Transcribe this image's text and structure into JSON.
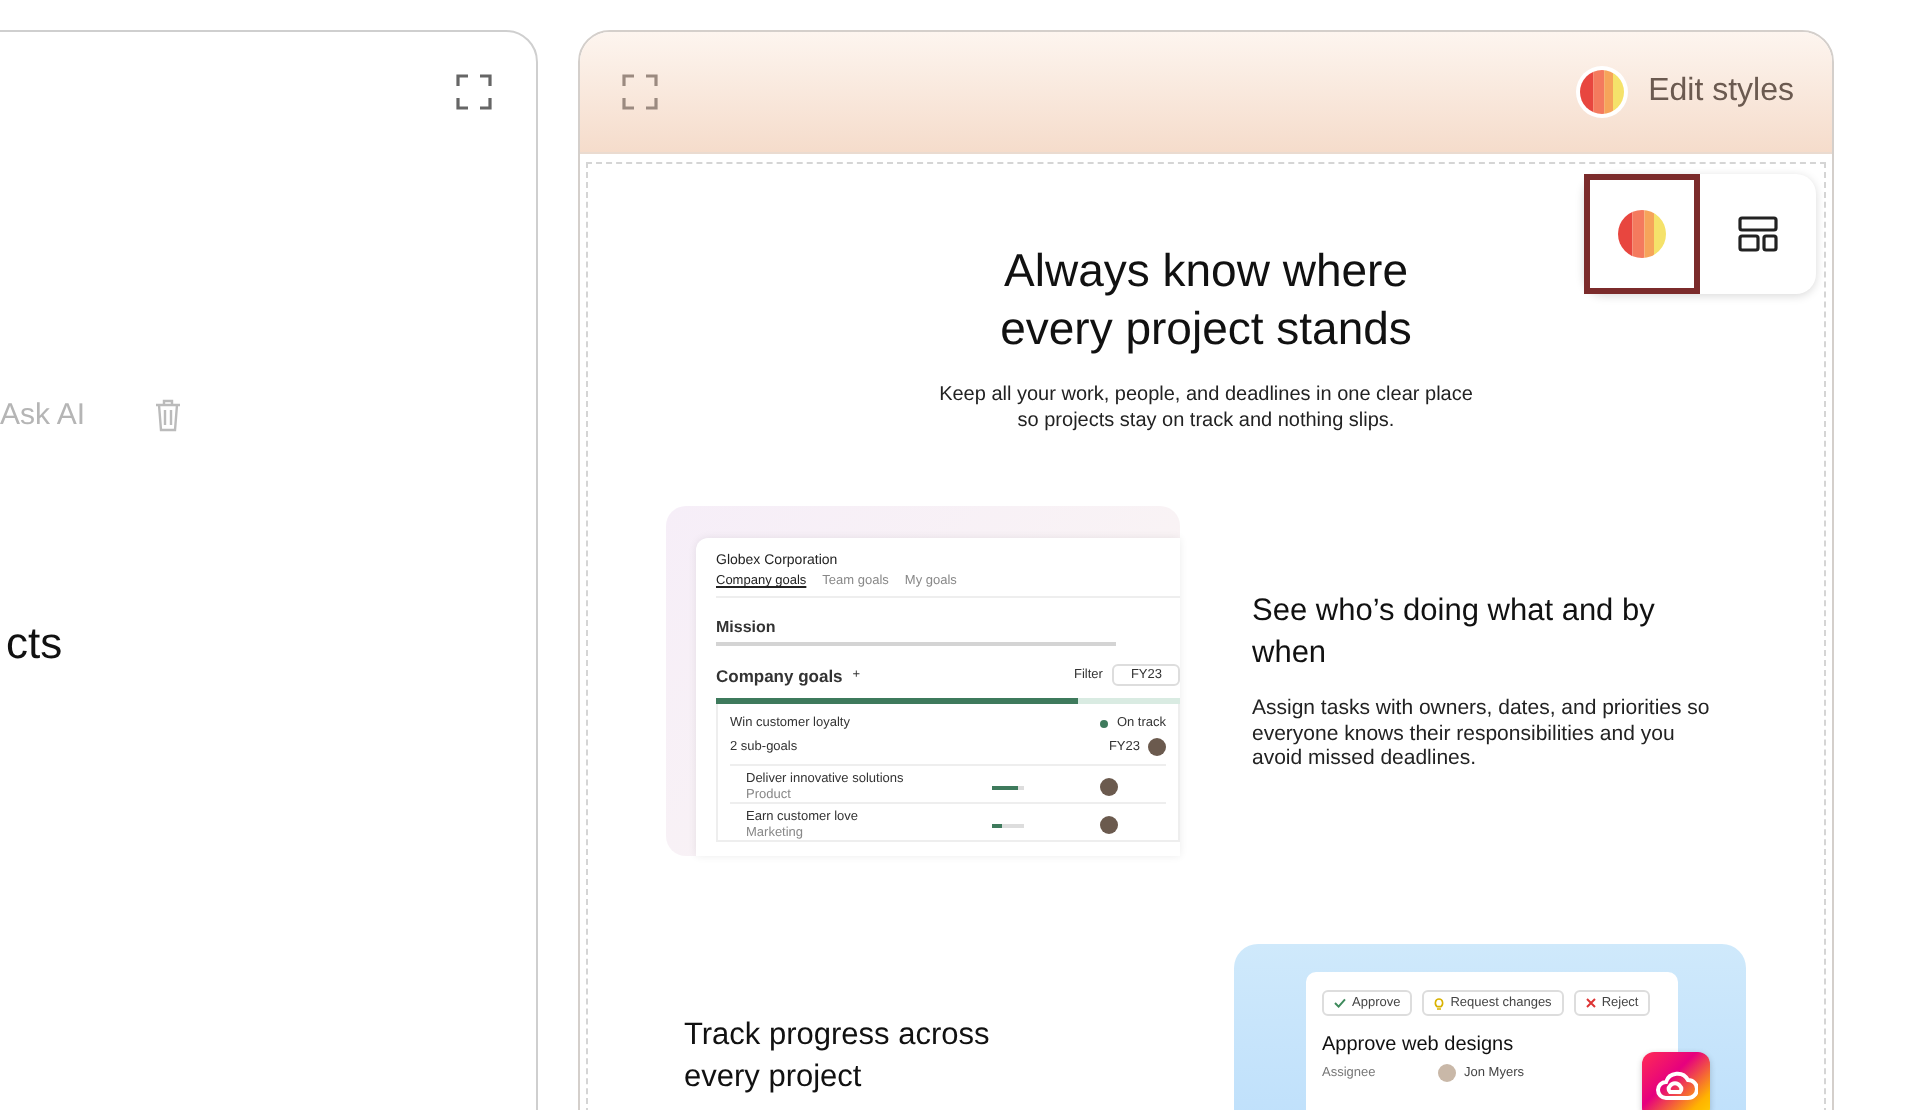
{
  "left_panel": {
    "ask_ai": "Ask AI",
    "heading_fragment": "cts"
  },
  "preview": {
    "edit_styles": "Edit styles",
    "toolbar": [
      {
        "kind": "palette",
        "selected": true
      },
      {
        "kind": "layout",
        "selected": false
      }
    ],
    "hero": {
      "title": "Always know where every project stands",
      "subtitle": "Keep all your work, people, and deadlines in one clear place so projects stay on track and nothing slips."
    },
    "features": [
      {
        "title": "See who’s doing what and by when",
        "body": "Assign tasks with owners, dates, and priorities so everyone knows their responsibilities and you avoid missed deadlines.",
        "mockup": {
          "kind": "goals",
          "company": "Globex Corporation",
          "tabs": [
            {
              "label": "Company goals",
              "selected": true
            },
            {
              "label": "Team goals",
              "selected": false
            },
            {
              "label": "My goals",
              "selected": false
            }
          ],
          "mission": "Mission",
          "goals_heading": "Company goals",
          "add": "+",
          "filter": "Filter",
          "period": "FY23",
          "level": 0.78,
          "goal": "Win customer loyalty",
          "status": "On track",
          "subgoal_toggle": "2 sub-goals",
          "goal_period": "FY23",
          "subgoals": [
            {
              "name": "Deliver innovative solutions",
              "team": "Product",
              "level": 0.8
            },
            {
              "name": "Earn customer love",
              "team": "Marketing",
              "level": 0.3
            }
          ]
        }
      },
      {
        "title": "Track progress across every project",
        "mockup": {
          "kind": "approval",
          "actions": [
            {
              "kind": "approve",
              "label": "Approve"
            },
            {
              "kind": "request",
              "label": "Request changes"
            },
            {
              "kind": "reject",
              "label": "Reject"
            }
          ],
          "task": "Approve web designs",
          "field": "Assignee",
          "assignee": "Jon Myers"
        }
      }
    ]
  }
}
